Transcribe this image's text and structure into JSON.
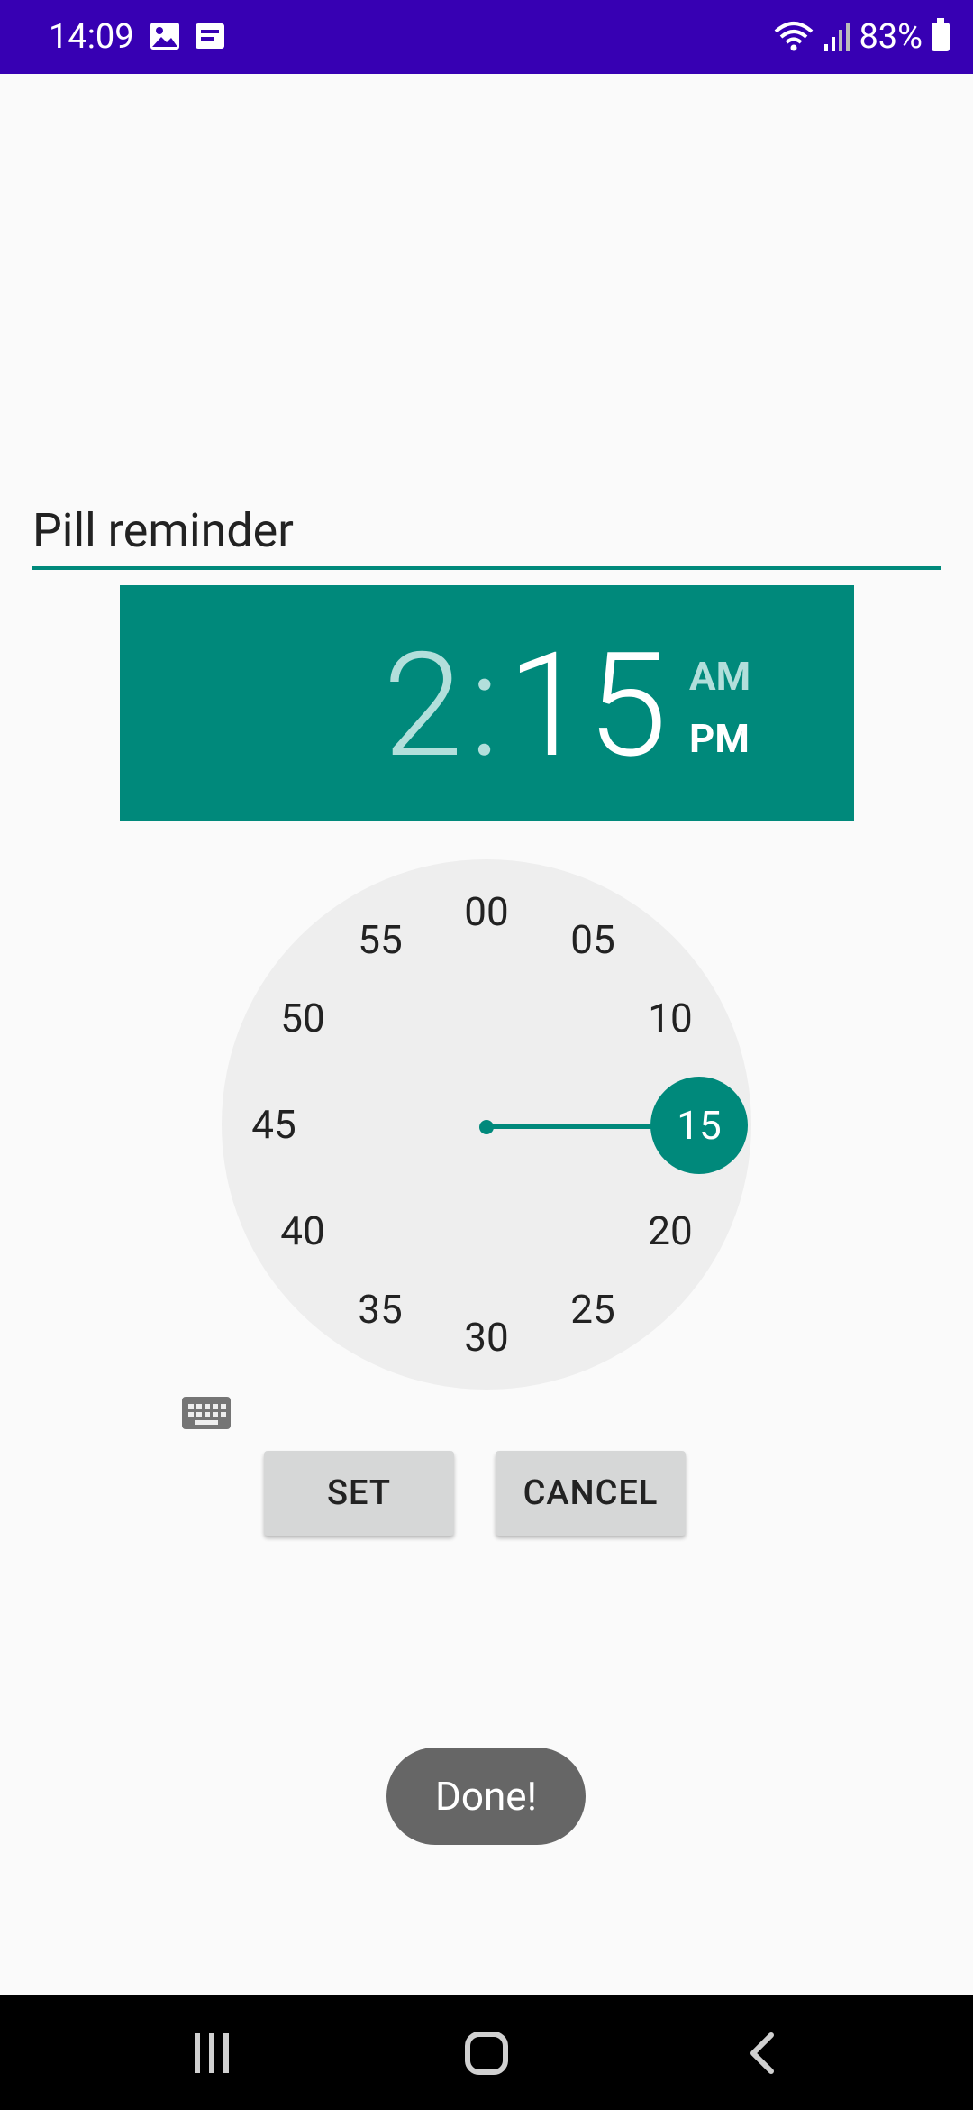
{
  "status_bar": {
    "time": "14:09",
    "battery": "83%"
  },
  "reminder": {
    "title": "Pill reminder"
  },
  "time_picker": {
    "hour": "2",
    "separator": ":",
    "minute": "15",
    "am_label": "AM",
    "pm_label": "PM",
    "selected_period": "PM",
    "mode": "minutes",
    "clock_numbers": [
      "00",
      "05",
      "10",
      "15",
      "20",
      "25",
      "30",
      "35",
      "40",
      "45",
      "50",
      "55"
    ],
    "selected_value": "15"
  },
  "buttons": {
    "set": "SET",
    "cancel": "CANCEL"
  },
  "toast": {
    "message": "Done!"
  },
  "colors": {
    "status_bar": "#3700b3",
    "accent": "#00897b",
    "clock_face": "#eeeeee",
    "button": "#d6d7d7",
    "toast": "#666666",
    "nav_bar": "#000000"
  },
  "icons": {
    "status_left": [
      "image-icon",
      "message-icon"
    ],
    "status_right": [
      "wifi-icon",
      "signal-icon",
      "battery-icon"
    ],
    "keyboard": "keyboard-icon",
    "nav": [
      "recent-apps-icon",
      "home-icon",
      "back-icon"
    ]
  }
}
